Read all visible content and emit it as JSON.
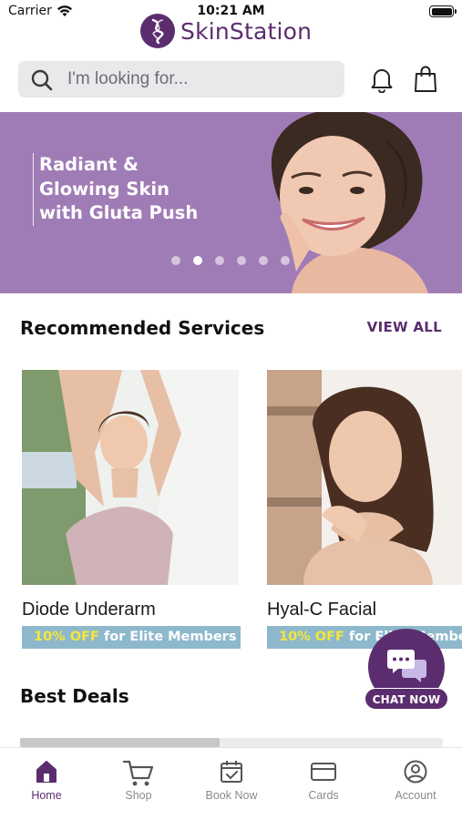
{
  "status_bar": {
    "carrier": "Carrier",
    "time": "10:21 AM"
  },
  "brand": {
    "name": "SkinStation",
    "color": "#5b2d6e"
  },
  "search": {
    "placeholder": "I'm looking for..."
  },
  "header_icons": [
    "search-icon",
    "bell-icon",
    "shopping-bag-icon"
  ],
  "banner": {
    "lines": [
      "Radiant &",
      "Glowing Skin",
      "with Gluta Push"
    ],
    "background": "#a07cb6",
    "slide_count": 6,
    "active_slide": 1
  },
  "recommended": {
    "title": "Recommended Services",
    "view_all": "VIEW ALL",
    "items": [
      {
        "title": "Diode Underarm",
        "promo_highlight": "10% OFF",
        "promo_rest": " for Elite Members"
      },
      {
        "title": "Hyal-C Facial",
        "promo_highlight": "10% OFF",
        "promo_rest": " for Elite Members"
      }
    ]
  },
  "best_deals": {
    "title": "Best Deals"
  },
  "chat": {
    "label": "CHAT NOW"
  },
  "tabs": [
    {
      "label": "Home",
      "icon": "home-icon",
      "active": true
    },
    {
      "label": "Shop",
      "icon": "cart-icon",
      "active": false
    },
    {
      "label": "Book Now",
      "icon": "calendar-check-icon",
      "active": false
    },
    {
      "label": "Cards",
      "icon": "card-icon",
      "active": false
    },
    {
      "label": "Account",
      "icon": "user-circle-icon",
      "active": false
    }
  ]
}
